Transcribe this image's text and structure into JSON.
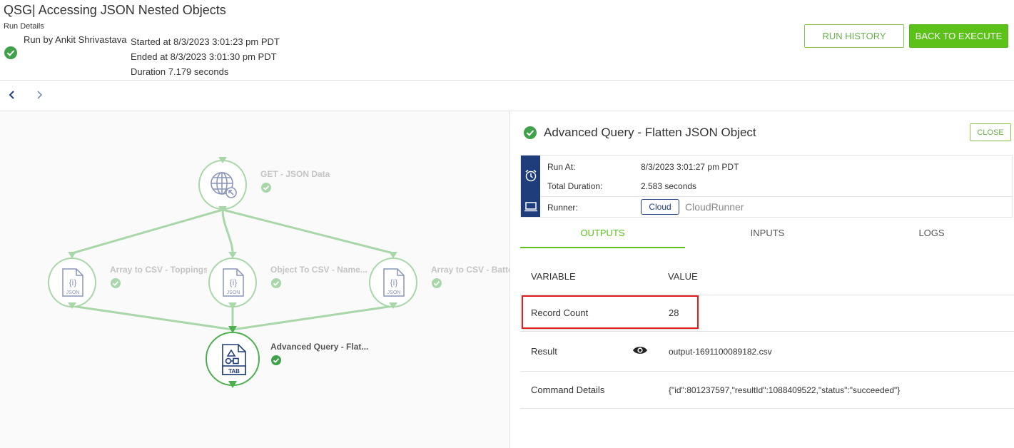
{
  "header": {
    "title": "QSG| Accessing JSON Nested Objects",
    "run_details_label": "Run Details",
    "run_by": "Run by Ankit Shrivastava",
    "started": "Started at 8/3/2023 3:01:23 pm PDT",
    "ended": "Ended at 8/3/2023 3:01:30 pm PDT",
    "duration": "Duration 7.179 seconds",
    "run_history_label": "RUN HISTORY",
    "back_to_execute_label": "BACK TO EXECUTE"
  },
  "flow": {
    "nodes": [
      {
        "label": "GET - JSON Data",
        "icon": "globe-icon"
      },
      {
        "label": "Array to CSV - Toppings",
        "icon": "json-file-icon"
      },
      {
        "label": "Object To CSV - Name...",
        "icon": "json-file-icon"
      },
      {
        "label": "Array to CSV - Batte",
        "icon": "json-file-icon"
      },
      {
        "label": "Advanced Query - Flat...",
        "icon": "tab-file-icon"
      }
    ]
  },
  "panel": {
    "title": "Advanced Query - Flatten JSON Object",
    "close_label": "CLOSE",
    "run_at_label": "Run At:",
    "run_at_value": "8/3/2023 3:01:27 pm PDT",
    "total_duration_label": "Total Duration:",
    "total_duration_value": "2.583 seconds",
    "runner_label": "Runner:",
    "runner_badge": "Cloud",
    "runner_value": "CloudRunner",
    "tabs": [
      "OUTPUTS",
      "INPUTS",
      "LOGS"
    ],
    "table": {
      "headers": [
        "VARIABLE",
        "VALUE"
      ],
      "rows": [
        {
          "variable": "Record Count",
          "value": "28"
        },
        {
          "variable": "Result",
          "value": "output-1691100089182.csv"
        },
        {
          "variable": "Command Details",
          "value": "{\"id\":801237597,\"resultId\":1088409522,\"status\":\"succeeded\"}"
        }
      ]
    }
  },
  "colors": {
    "accent_green": "#5cc21a",
    "success_green": "#3fa14a",
    "navy": "#1f3d7a",
    "highlight_red": "#e01e1e"
  }
}
